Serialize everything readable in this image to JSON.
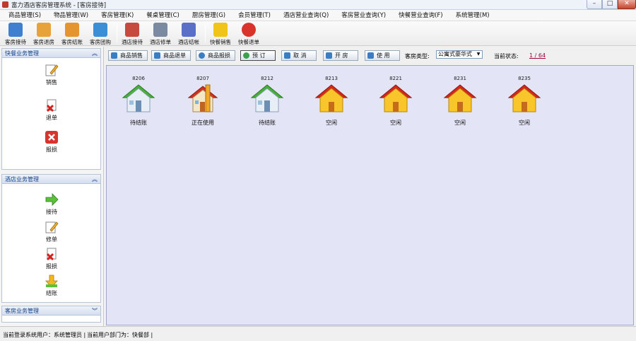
{
  "window": {
    "title": "富力酒店客房管理系统 - [客房接待]",
    "min_glyph": "–",
    "max_glyph": "□",
    "close_glyph": "✕"
  },
  "menu": [
    "商品管理(S)",
    "物品管理(W)",
    "客房管理(K)",
    "餐桌管理(C)",
    "厨房管理(G)",
    "会员管理(T)",
    "酒店营业查询(Q)",
    "客房营业查询(Y)",
    "快餐营业查询(F)",
    "系统管理(M)"
  ],
  "toolbar": {
    "items": [
      {
        "label": "客房接待",
        "icon": "key-card-icon",
        "color": "#3f7fd0"
      },
      {
        "label": "客房退房",
        "icon": "checkout-icon",
        "color": "#e8a23a"
      },
      {
        "label": "客房结账",
        "icon": "undo-arrow-icon",
        "color": "#e5952f"
      },
      {
        "label": "客房团购",
        "icon": "group-buy-icon",
        "color": "#3b8fd6"
      },
      {
        "label": "酒店接待",
        "icon": "reception-card-icon",
        "color": "#c64a3e"
      },
      {
        "label": "酒店修单",
        "icon": "tools-icon",
        "color": "#7a8aa0"
      },
      {
        "label": "酒店结帐",
        "icon": "checkout-book-icon",
        "color": "#5a6fc7"
      },
      {
        "label": "快餐销售",
        "icon": "star-sale-icon",
        "color": "#f0c419"
      },
      {
        "label": "快餐退单",
        "icon": "red-return-icon",
        "color": "#d9342b"
      }
    ]
  },
  "sidebar": {
    "panel1": {
      "title": "快餐业务管理",
      "items": [
        {
          "label": "销售",
          "icon": "pencil-note-icon"
        },
        {
          "label": "退单",
          "icon": "delete-doc-icon"
        },
        {
          "label": "报损",
          "icon": "red-x-icon"
        }
      ]
    },
    "panel2": {
      "title": "酒店业务管理",
      "items": [
        {
          "label": "接待",
          "icon": "green-arrow-icon"
        },
        {
          "label": "修单",
          "icon": "pencil-note-icon"
        },
        {
          "label": "报损",
          "icon": "delete-doc-icon"
        },
        {
          "label": "结账",
          "icon": "yellow-arrow-icon"
        }
      ]
    },
    "panel3": {
      "title": "客房业务管理"
    }
  },
  "actions": [
    {
      "label": "商品销售",
      "icon": "sale-icon",
      "color": "#3c7cc5"
    },
    {
      "label": "商品退单",
      "icon": "return-icon",
      "color": "#3c7cc5"
    },
    {
      "label": "商品报损",
      "icon": "loss-icon",
      "color": "#3c7cc5"
    },
    {
      "label": "预 订",
      "icon": "add-icon",
      "color": "#3aa34a"
    },
    {
      "label": "取 消",
      "icon": "cancel-icon",
      "color": "#3c7cc5"
    },
    {
      "label": "开 房",
      "icon": "open-room-icon",
      "color": "#3c7cc5"
    },
    {
      "label": "使 用",
      "icon": "play-icon",
      "color": "#3c7cc5"
    }
  ],
  "filter": {
    "room_type_label": "客房类型:",
    "room_type_value": "公寓式豪华式",
    "status_label": "当前状态:",
    "status_value": "1 / 64"
  },
  "rooms": [
    {
      "number": "8206",
      "status": "待结账",
      "style": "green"
    },
    {
      "number": "8207",
      "status": "正在使用",
      "style": "occupied"
    },
    {
      "number": "8212",
      "status": "待结账",
      "style": "green"
    },
    {
      "number": "8213",
      "status": "空闲",
      "style": "vacant"
    },
    {
      "number": "8221",
      "status": "空闲",
      "style": "vacant"
    },
    {
      "number": "8231",
      "status": "空闲",
      "style": "vacant"
    },
    {
      "number": "8235",
      "status": "空闲",
      "style": "vacant"
    }
  ],
  "statusbar": {
    "user": "当前登录系统用户：系统管理员 |",
    "dept": "当前用户部门为：快餐部 |"
  }
}
